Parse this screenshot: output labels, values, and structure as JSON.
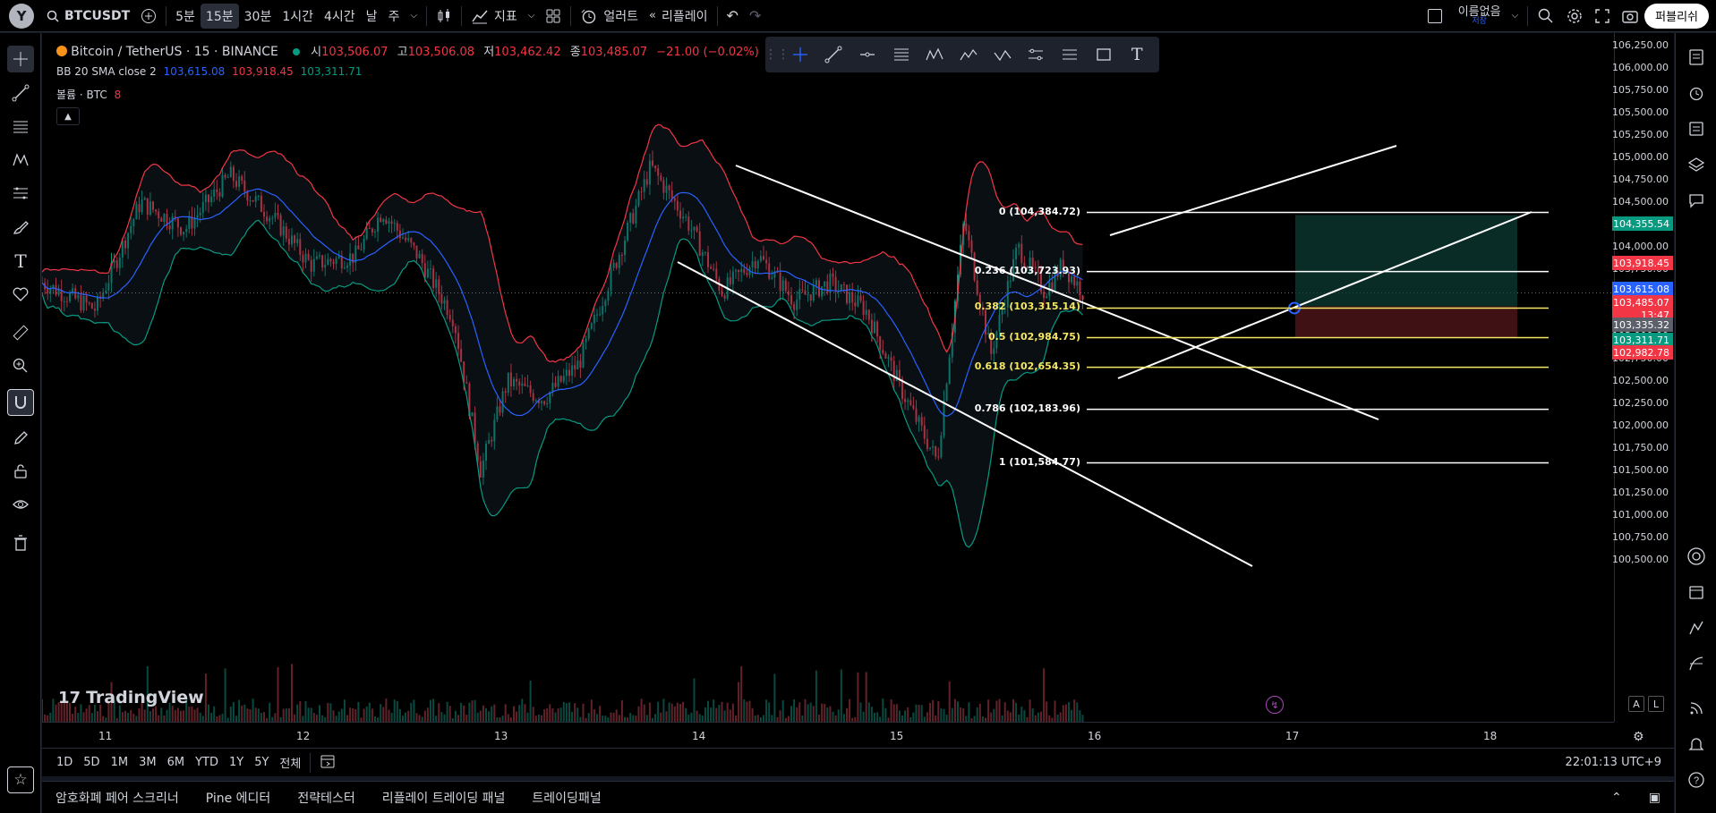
{
  "topbar": {
    "avatar": "Y",
    "symbol": "BTCUSDT",
    "timeframes": [
      "5분",
      "15분",
      "30분",
      "1시간",
      "4시간",
      "날",
      "주"
    ],
    "indicators_label": "지표",
    "alert_label": "얼러트",
    "replay_label": "리플레이",
    "layout_name": "이름없음",
    "layout_status": "저장",
    "publish_label": "퍼블리쉬"
  },
  "legend": {
    "symbol_title": "Bitcoin / TetherUS · 15 · BINANCE",
    "o_label": "시",
    "o_val": "103,506.07",
    "h_label": "고",
    "h_val": "103,506.08",
    "l_label": "저",
    "l_val": "103,462.42",
    "c_label": "종",
    "c_val": "103,485.07",
    "change": "−21.00 (−0.02%)",
    "bb_label": "BB 20 SMA close 2",
    "bb_basis": "103,615.08",
    "bb_upper": "103,918.45",
    "bb_lower": "103,311.71",
    "vol_label": "볼륨 · BTC",
    "vol_val": "8"
  },
  "fib_levels": [
    {
      "label": "0 (104,384.72)",
      "price": 104384.72,
      "color": "#ffffff"
    },
    {
      "label": "0.236 (103,723.93)",
      "price": 103723.93,
      "color": "#ffffff"
    },
    {
      "label": "0.382 (103,315.14)",
      "price": 103315.14,
      "color": "#f5e663"
    },
    {
      "label": "0.5 (102,984.75)",
      "price": 102984.75,
      "color": "#f5e663"
    },
    {
      "label": "0.618 (102,654.35)",
      "price": 102654.35,
      "color": "#f5e663"
    },
    {
      "label": "0.786 (102,183.96)",
      "price": 102183.96,
      "color": "#ffffff"
    },
    {
      "label": "1 (101,584.77)",
      "price": 101584.77,
      "color": "#ffffff"
    }
  ],
  "price_axis": {
    "ticks": [
      "106,250.00",
      "106,000.00",
      "105,750.00",
      "105,500.00",
      "105,250.00",
      "105,000.00",
      "104,750.00",
      "104,500.00",
      "104,250.00",
      "104,000.00",
      "103,750.00",
      "103,500.00",
      "103,250.00",
      "103,000.00",
      "102,750.00",
      "102,500.00",
      "102,250.00",
      "102,000.00",
      "101,750.00",
      "101,500.00",
      "101,250.00",
      "101,000.00",
      "100,750.00",
      "100,500.00"
    ],
    "badges": [
      {
        "text": "104,355.54",
        "color": "#089981"
      },
      {
        "text": "103,918.45",
        "color": "#f23645"
      },
      {
        "text": "103,615.08",
        "color": "#2962ff"
      },
      {
        "text": "103,485.07",
        "color": "#f23645"
      },
      {
        "text": "13:47",
        "color": "#f23645"
      },
      {
        "text": "103,335.32",
        "color": "#5d606b"
      },
      {
        "text": "103,311.71",
        "color": "#089981"
      },
      {
        "text": "102,982.78",
        "color": "#f23645"
      }
    ]
  },
  "time_axis": [
    "11",
    "12",
    "13",
    "14",
    "15",
    "16",
    "17",
    "18"
  ],
  "range_bar": {
    "ranges": [
      "1D",
      "5D",
      "1M",
      "3M",
      "6M",
      "YTD",
      "1Y",
      "5Y",
      "전체"
    ],
    "clock": "22:01:13 UTC+9"
  },
  "bottom_panel": [
    "암호화폐 페어 스크리너",
    "Pine 에디터",
    "전략테스터",
    "리플레이 트레이딩 패널",
    "트레이딩패널"
  ],
  "logo": "TradingView",
  "al": {
    "a": "A",
    "l": "L"
  }
}
